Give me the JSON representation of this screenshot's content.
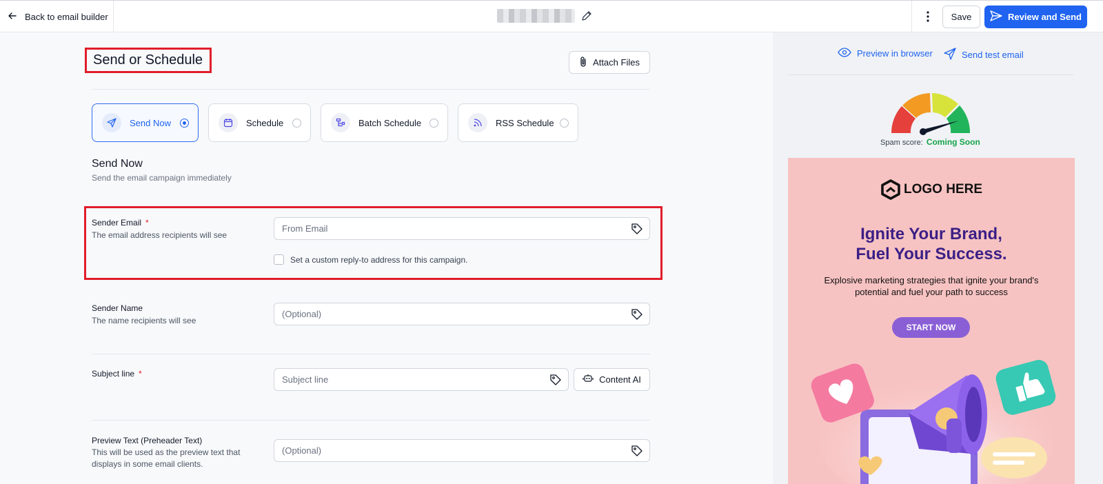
{
  "topbar": {
    "back_label": "Back to email builder",
    "save_label": "Save",
    "review_label": "Review and Send"
  },
  "header": {
    "title": "Send or Schedule",
    "attach_label": "Attach Files"
  },
  "send_options": [
    {
      "label": "Send Now",
      "selected": true
    },
    {
      "label": "Schedule",
      "selected": false
    },
    {
      "label": "Batch Schedule",
      "selected": false
    },
    {
      "label": "RSS Schedule",
      "selected": false
    }
  ],
  "section": {
    "title": "Send Now",
    "subtitle": "Send the email campaign immediately"
  },
  "sender_email": {
    "label": "Sender Email",
    "required": "*",
    "help": "The email address recipients will see",
    "placeholder": "From Email",
    "reply_to_label": "Set a custom reply-to address for this campaign."
  },
  "sender_name": {
    "label": "Sender Name",
    "help": "The name recipients will see",
    "placeholder": "(Optional)"
  },
  "subject": {
    "label": "Subject line",
    "required": "*",
    "placeholder": "Subject line",
    "content_ai_label": "Content AI"
  },
  "preview_text": {
    "label": "Preview Text (Preheader Text)",
    "help": "This will be used as the preview text that displays in some email clients.",
    "placeholder": "(Optional)"
  },
  "right_panel": {
    "preview_browser": "Preview in browser",
    "send_test": "Send test email",
    "spam_label": "Spam score:",
    "spam_value": "Coming Soon",
    "colors": {
      "gauge": [
        "#e5403b",
        "#f39a22",
        "#d7e23a",
        "#22b45a"
      ]
    }
  },
  "email_preview": {
    "logo_text": "LOGO HERE",
    "headline_1": "Ignite Your Brand,",
    "headline_2": "Fuel Your Success.",
    "body": "Explosive marketing strategies that ignite your brand's potential and fuel your path to success",
    "cta": "START NOW"
  },
  "colors": {
    "primary": "#1f63f0",
    "highlight": "#e11d2a",
    "email_bg": "#f7c3c2",
    "headline": "#3b1f86",
    "cta": "#8a5fd6"
  }
}
